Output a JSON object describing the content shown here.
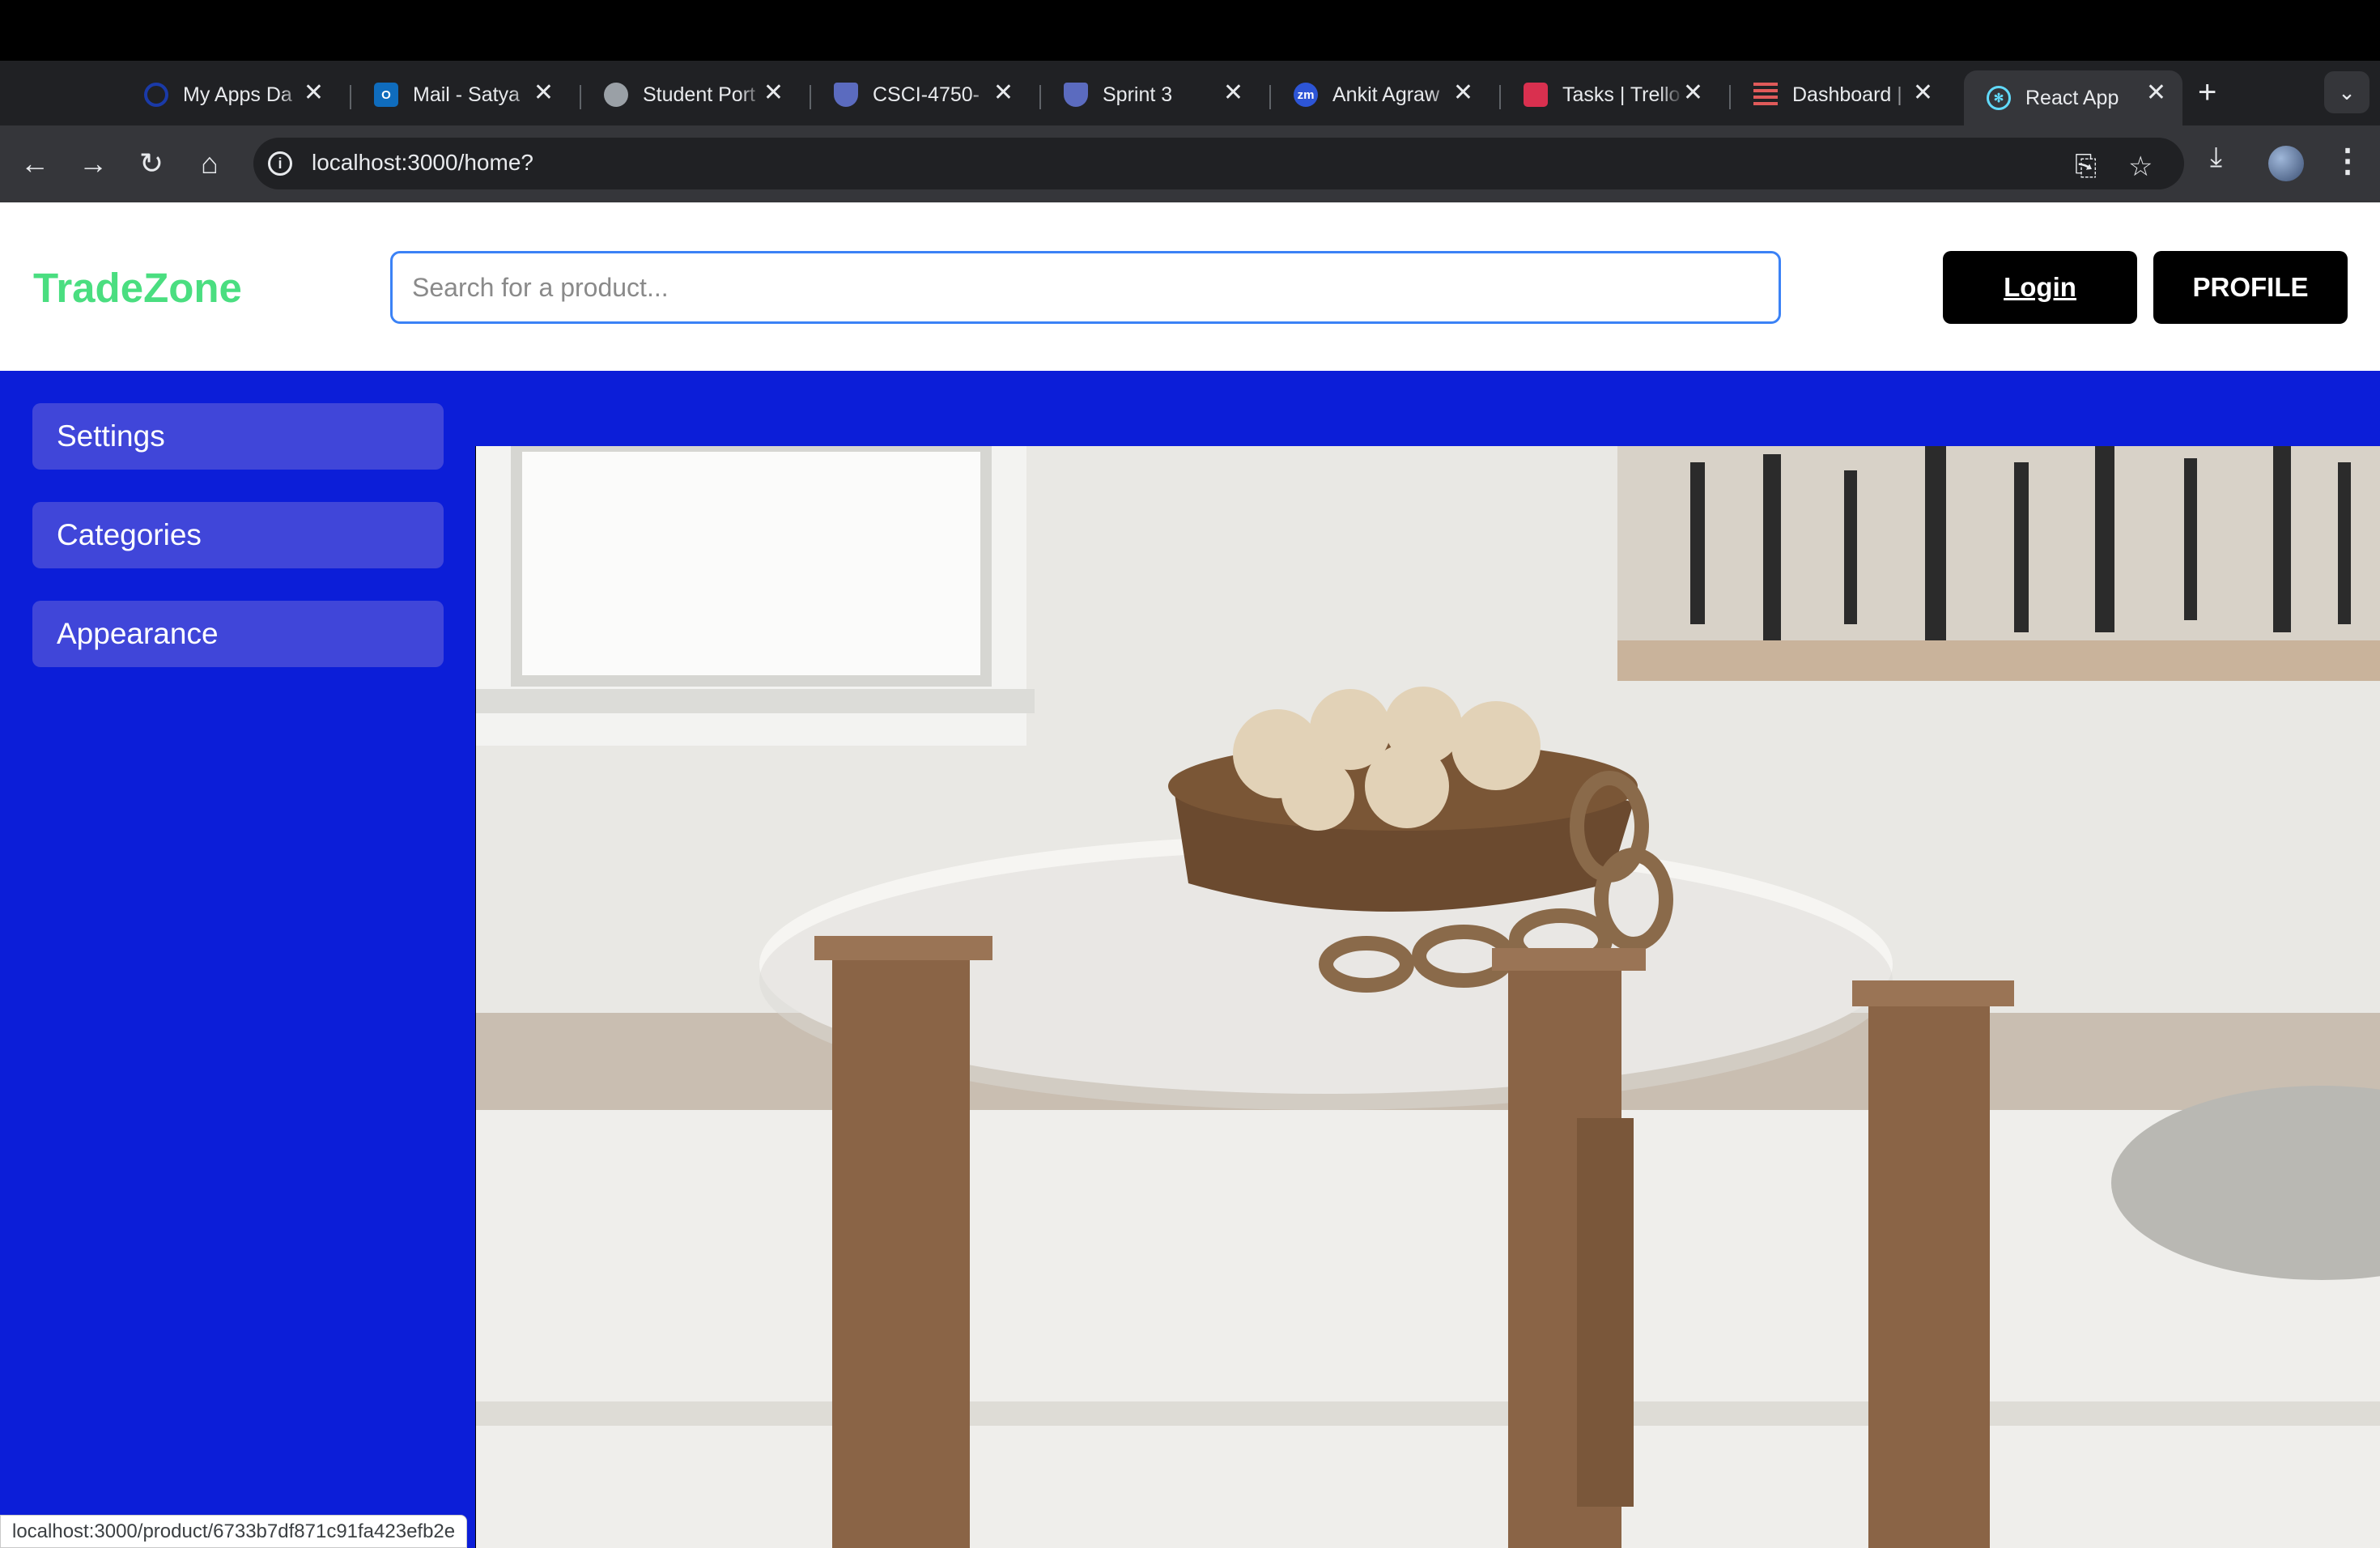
{
  "browser": {
    "tabs": [
      {
        "label": "My Apps Da",
        "icon": "okta-icon",
        "color": "#1a3aa8"
      },
      {
        "label": "Mail - Satya",
        "icon": "outlook-icon",
        "color": "#0f6cbd"
      },
      {
        "label": "Student Port",
        "icon": "globe-icon",
        "color": "#9aa0a6"
      },
      {
        "label": "CSCI-4750-",
        "icon": "shield-icon",
        "color": "#5b6bbf"
      },
      {
        "label": "Sprint 3",
        "icon": "shield-icon",
        "color": "#5b6bbf"
      },
      {
        "label": "Ankit Agraw",
        "icon": "zoom-icon",
        "color": "#2d55d6"
      },
      {
        "label": "Tasks | Trello",
        "icon": "trello-icon",
        "color": "#d9304f"
      },
      {
        "label": "Dashboard |",
        "icon": "dashboard-icon",
        "color": "#e05a5a"
      },
      {
        "label": "React App",
        "icon": "react-icon",
        "color": "#61dafb"
      }
    ],
    "active_tab": 8,
    "url": "localhost:3000/home?",
    "status_url": "localhost:3000/product/6733b7df871c91fa423efb2e"
  },
  "app": {
    "brand": "TradeZone",
    "brand_color": "#4ade80",
    "accent": "#0c1ed8",
    "search": {
      "placeholder": "Search for a product...",
      "value": ""
    },
    "login_label": "Login",
    "profile_label": "PROFILE",
    "sidebar": {
      "items": [
        {
          "label": "Settings"
        },
        {
          "label": "Categories"
        },
        {
          "label": "Appearance"
        }
      ]
    }
  }
}
